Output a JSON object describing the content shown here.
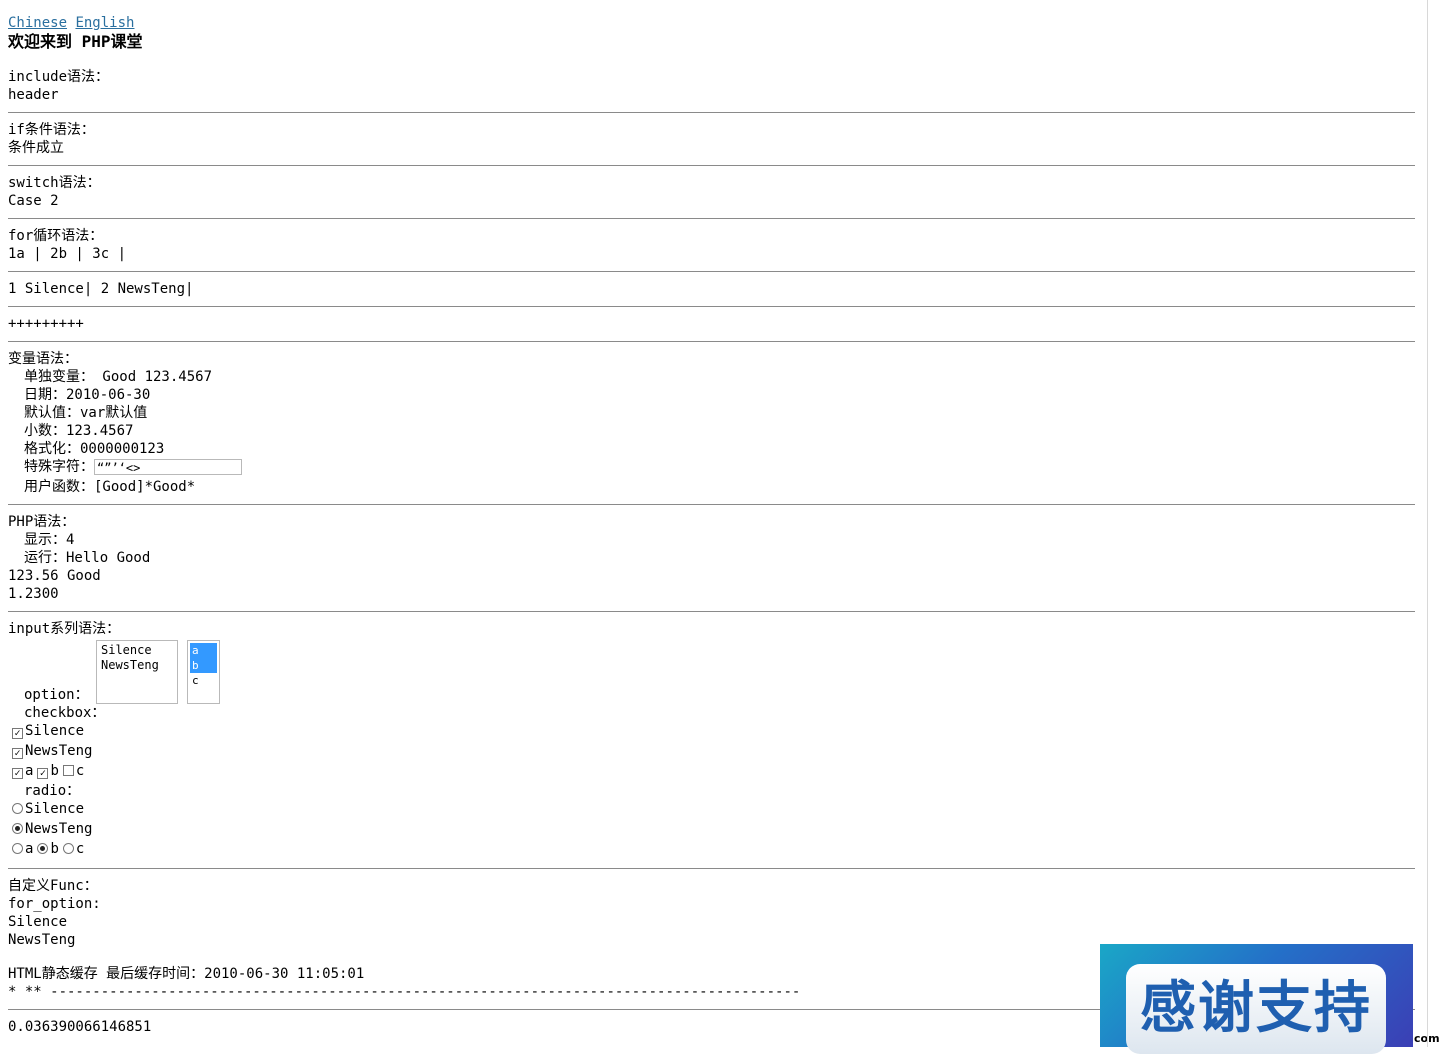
{
  "lang": {
    "chinese": "Chinese",
    "english": "English"
  },
  "title": "欢迎来到 PHP课堂",
  "include": {
    "label": "include语法：",
    "value": "header"
  },
  "if_block": {
    "label": "if条件语法：",
    "value": "条件成立"
  },
  "switch_block": {
    "label": "switch语法：",
    "value": "Case 2"
  },
  "for_block": {
    "label": "for循环语法：",
    "value": "1a | 2b | 3c |"
  },
  "list_line": "1 Silence| 2 NewsTeng|",
  "plus_line": "+++++++++",
  "var": {
    "label": "变量语法：",
    "single": "单独变量： Good 123.4567",
    "date": "日期：2010-06-30",
    "default": "默认值：var默认值",
    "decimal": "小数：123.4567",
    "format": "格式化：0000000123",
    "special_label": "特殊字符：",
    "special_value": "“”’‘<>",
    "userfunc": "用户函数：[Good]*Good*"
  },
  "php": {
    "label": "PHP语法：",
    "show": "显示：4",
    "run": "运行：Hello Good",
    "line3": "123.56 Good",
    "line4": "1.2300"
  },
  "input": {
    "label": "input系列语法：",
    "option_label": "option：",
    "listbox1": [
      "Silence",
      "NewsTeng"
    ],
    "listbox2": [
      "a",
      "b",
      "c"
    ],
    "checkbox_label": "checkbox：",
    "cb_silence": "Silence",
    "cb_newsteng": "NewsTeng",
    "cb_a": "a",
    "cb_b": "b",
    "cb_c": "c",
    "radio_label": "radio：",
    "rd_silence": "Silence",
    "rd_newsteng": "NewsTeng",
    "rd_a": "a",
    "rd_b": "b",
    "rd_c": "c"
  },
  "func": {
    "label": "自定义Func：",
    "for_option": "for_option:",
    "item1": "Silence",
    "item2": "NewsTeng"
  },
  "cache": {
    "line": "HTML静态缓存 最后缓存时间：2010-06-30 11:05:01",
    "stars": "* ** -----------------------------------------------------------------------------------------"
  },
  "timing": "0.036390066146851",
  "ad": {
    "text": "感谢支持"
  },
  "corner_text": "com"
}
